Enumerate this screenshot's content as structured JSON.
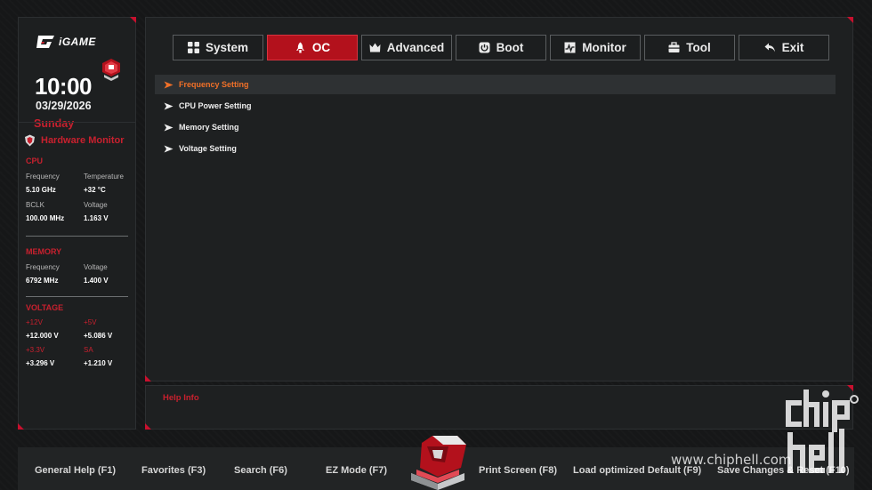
{
  "brand": {
    "logo_text": "iGAME"
  },
  "clock": {
    "time": "10:00",
    "date": "03/29/2026",
    "day": "Sunday"
  },
  "hardware_monitor": {
    "title": "Hardware Monitor",
    "cpu": {
      "label": "CPU",
      "frequency_label": "Frequency",
      "frequency": "5.10 GHz",
      "temperature_label": "Temperature",
      "temperature": "+32 °C",
      "bclk_label": "BCLK",
      "bclk": "100.00 MHz",
      "voltage_label": "Voltage",
      "voltage": "1.163 V"
    },
    "memory": {
      "label": "MEMORY",
      "frequency_label": "Frequency",
      "frequency": "6792 MHz",
      "voltage_label": "Voltage",
      "voltage": "1.400 V"
    },
    "voltage": {
      "label": "VOLTAGE",
      "v12_label": "+12V",
      "v12": "+12.000 V",
      "v5_label": "+5V",
      "v5": "+5.086 V",
      "v33_label": "+3.3V",
      "v33": "+3.296 V",
      "sa_label": "SA",
      "sa": "+1.210 V"
    }
  },
  "tabs": [
    {
      "label": "System",
      "icon": "grid-icon"
    },
    {
      "label": "OC",
      "icon": "rocket-icon",
      "active": true
    },
    {
      "label": "Advanced",
      "icon": "crown-icon"
    },
    {
      "label": "Boot",
      "icon": "power-icon"
    },
    {
      "label": "Monitor",
      "icon": "pulse-icon"
    },
    {
      "label": "Tool",
      "icon": "toolbox-icon"
    },
    {
      "label": "Exit",
      "icon": "return-icon"
    }
  ],
  "menu": [
    {
      "label": "Frequency Setting",
      "active": true
    },
    {
      "label": "CPU Power Setting"
    },
    {
      "label": "Memory Setting"
    },
    {
      "label": "Voltage Setting"
    }
  ],
  "help": {
    "title": "Help Info"
  },
  "footer": {
    "general_help": "General Help (F1)",
    "favorites": "Favorites (F3)",
    "search": "Search (F6)",
    "ez_mode": "EZ Mode (F7)",
    "print_screen": "Print Screen (F8)",
    "load_default": "Load optimized Default (F9)",
    "save_reset": "Save Changes & Reset (F10)"
  },
  "watermark": {
    "text": "www.chiphell.com",
    "logo_lines": [
      "chip",
      "hell"
    ]
  },
  "colors": {
    "accent": "#c8202e",
    "active_tab": "#b3111c",
    "active_menu_text": "#f07028",
    "panel": "#1e2021",
    "background": "#161718"
  }
}
